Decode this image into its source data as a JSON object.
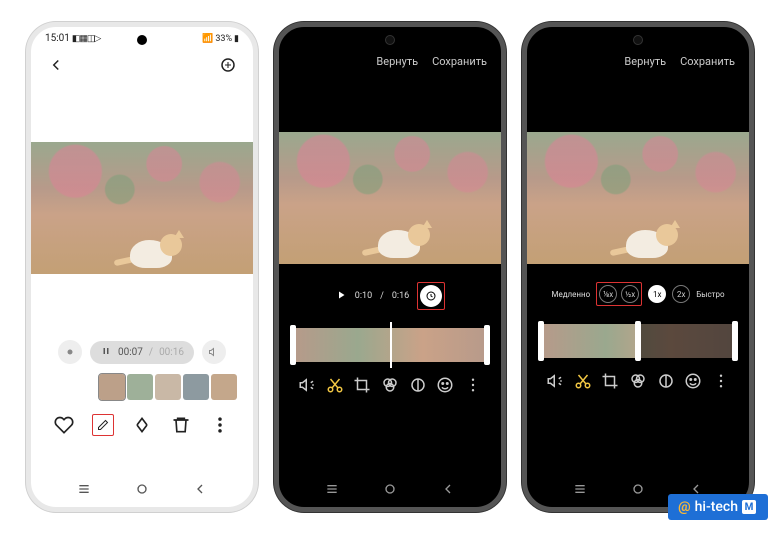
{
  "phone1": {
    "status": {
      "time": "15:01",
      "battery": "33%"
    },
    "playback": {
      "current": "00:07",
      "total": "00:16"
    }
  },
  "phone2": {
    "top": {
      "revert": "Вернуть",
      "save": "Сохранить"
    },
    "playback": {
      "current": "0:10",
      "total": "0:16"
    }
  },
  "phone3": {
    "top": {
      "revert": "Вернуть",
      "save": "Сохранить"
    },
    "speed": {
      "slow_label": "Медленно",
      "fast_label": "Быстро",
      "options": [
        "⅛x",
        "½x",
        "1x",
        "2x"
      ]
    }
  },
  "watermark": {
    "at": "@",
    "text": "hi-tech",
    "badge": "M"
  }
}
